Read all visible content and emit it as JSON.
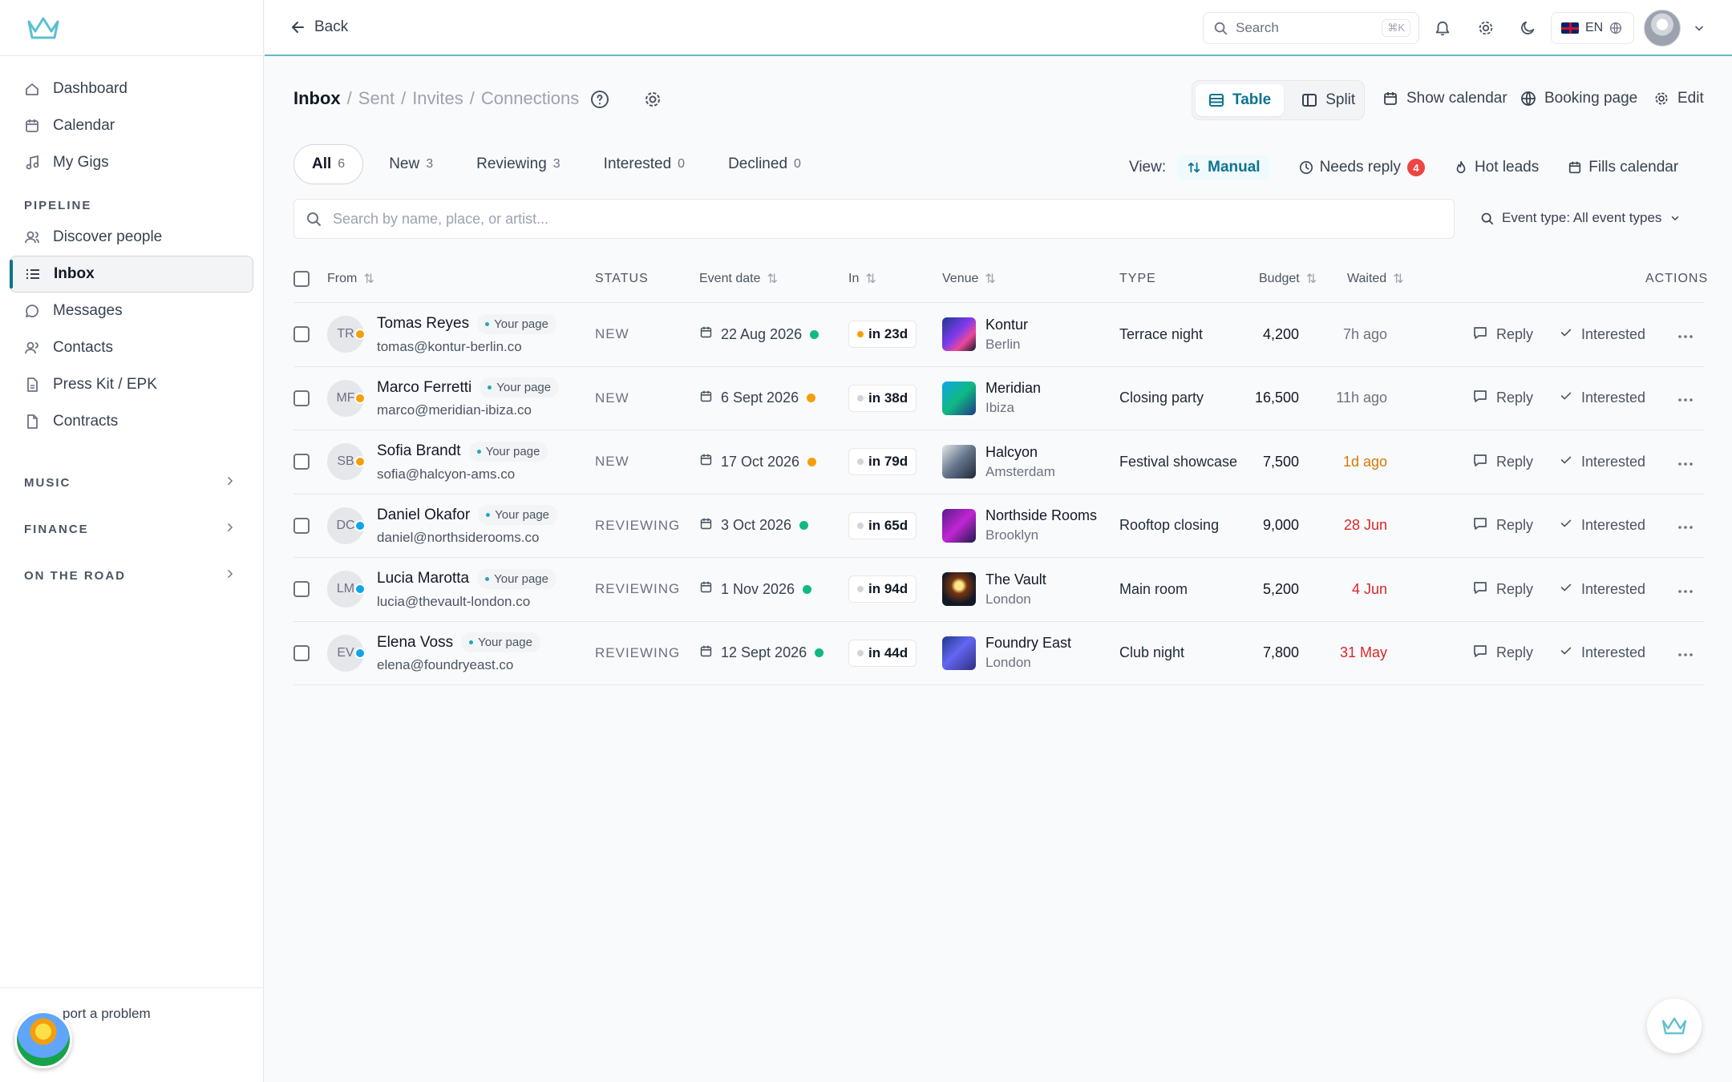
{
  "app": {
    "brand_color": "#5bc0d0"
  },
  "sidebar": {
    "main_items": [
      {
        "label": "Dashboard",
        "icon": "home-icon"
      },
      {
        "label": "Calendar",
        "icon": "calendar-icon"
      },
      {
        "label": "My Gigs",
        "icon": "music-note-icon"
      }
    ],
    "pipeline_label": "PIPELINE",
    "pipeline_items": [
      {
        "label": "Discover people",
        "icon": "users-icon"
      },
      {
        "label": "Inbox",
        "icon": "list-icon",
        "active": true
      },
      {
        "label": "Messages",
        "icon": "message-icon"
      },
      {
        "label": "Contacts",
        "icon": "contacts-icon"
      },
      {
        "label": "Press Kit / EPK",
        "icon": "file-icon"
      },
      {
        "label": "Contracts",
        "icon": "document-icon"
      }
    ],
    "groups": [
      "MUSIC",
      "FINANCE",
      "ON THE ROAD"
    ],
    "footer_label": "port a problem"
  },
  "topbar": {
    "back_label": "Back",
    "search_placeholder": "Search",
    "search_shortcut": "⌘K",
    "lang": "EN"
  },
  "header": {
    "crumbs": [
      "Inbox",
      "Sent",
      "Invites",
      "Connections"
    ],
    "view_table": "Table",
    "view_split": "Split",
    "show_calendar": "Show calendar",
    "booking_page": "Booking page",
    "edit": "Edit"
  },
  "tabs": [
    {
      "label": "All",
      "count": "6",
      "active": true
    },
    {
      "label": "New",
      "count": "3"
    },
    {
      "label": "Reviewing",
      "count": "3"
    },
    {
      "label": "Interested",
      "count": "0"
    },
    {
      "label": "Declined",
      "count": "0"
    }
  ],
  "viewbar": {
    "label": "View:",
    "manual": "Manual",
    "needs_reply": "Needs reply",
    "needs_reply_count": "4",
    "hot_leads": "Hot leads",
    "fills_calendar": "Fills calendar"
  },
  "search": {
    "placeholder": "Search by name, place, or artist...",
    "event_type": "Event type: All event types"
  },
  "table": {
    "headers": {
      "from": "From",
      "status": "STATUS",
      "event_date": "Event date",
      "in": "In",
      "venue": "Venue",
      "type": "TYPE",
      "budget": "Budget",
      "waited": "Waited",
      "actions": "ACTIONS"
    },
    "your_page_label": "Your page",
    "reply_label": "Reply",
    "interested_label": "Interested",
    "rows": [
      {
        "initials": "TR",
        "name": "Tomas Reyes",
        "email": "tomas@kontur-berlin.co",
        "status": "NEW",
        "date": "22 Aug 2026",
        "in": "in 23d",
        "venue": "Kontur",
        "city": "Berlin",
        "type": "Terrace night",
        "budget": "4,200",
        "waited": "7h ago",
        "avatar_dot": "#f59e0b",
        "date_dot": "#10b981",
        "in_dot": "#f59e0b",
        "waited_color": "#6b7280",
        "thumb": "linear-gradient(135deg,#1e3a8a,#7c3aed 45%,#ec4899 70%,#0f172a)"
      },
      {
        "initials": "MF",
        "name": "Marco Ferretti",
        "email": "marco@meridian-ibiza.co",
        "status": "NEW",
        "date": "6 Sept 2026",
        "in": "in 38d",
        "venue": "Meridian",
        "city": "Ibiza",
        "type": "Closing party",
        "budget": "16,500",
        "waited": "11h ago",
        "avatar_dot": "#f59e0b",
        "date_dot": "#f59e0b",
        "in_dot": "#d1d5db",
        "waited_color": "#6b7280",
        "thumb": "linear-gradient(135deg,#0ea5e9,#10b981 50%,#1e3a8a)"
      },
      {
        "initials": "SB",
        "name": "Sofia Brandt",
        "email": "sofia@halcyon-ams.co",
        "status": "NEW",
        "date": "17 Oct 2026",
        "in": "in 79d",
        "venue": "Halcyon",
        "city": "Amsterdam",
        "type": "Festival showcase",
        "budget": "7,500",
        "waited": "1d ago",
        "avatar_dot": "#f59e0b",
        "date_dot": "#f59e0b",
        "in_dot": "#d1d5db",
        "waited_color": "#d97706",
        "thumb": "linear-gradient(135deg,#e5e7eb,#64748b 50%,#1f2937)"
      },
      {
        "initials": "DC",
        "name": "Daniel Okafor",
        "email": "daniel@northsiderooms.co",
        "status": "REVIEWING",
        "date": "3 Oct 2026",
        "in": "in 65d",
        "venue": "Northside Rooms",
        "city": "Brooklyn",
        "type": "Rooftop closing",
        "budget": "9,000",
        "waited": "28 Jun",
        "avatar_dot": "#0ea5e9",
        "date_dot": "#10b981",
        "in_dot": "#d1d5db",
        "waited_color": "#dc2626",
        "thumb": "linear-gradient(135deg,#581c87,#c026d3 50%,#1e1b4b)"
      },
      {
        "initials": "LM",
        "name": "Lucia Marotta",
        "email": "lucia@thevault-london.co",
        "status": "REVIEWING",
        "date": "1 Nov 2026",
        "in": "in 94d",
        "venue": "The Vault",
        "city": "London",
        "type": "Main room",
        "budget": "5,200",
        "waited": "4 Jun",
        "avatar_dot": "#0ea5e9",
        "date_dot": "#10b981",
        "in_dot": "#d1d5db",
        "waited_color": "#dc2626",
        "thumb": "radial-gradient(circle at 50% 40%,#fde68a 0 15%,#78350f 30%,#111827 70%)"
      },
      {
        "initials": "EV",
        "name": "Elena Voss",
        "email": "elena@foundryeast.co",
        "status": "REVIEWING",
        "date": "12 Sept 2026",
        "in": "in 44d",
        "venue": "Foundry East",
        "city": "London",
        "type": "Club night",
        "budget": "7,800",
        "waited": "31 May",
        "avatar_dot": "#0ea5e9",
        "date_dot": "#10b981",
        "in_dot": "#d1d5db",
        "waited_color": "#dc2626",
        "thumb": "linear-gradient(135deg,#1e3a8a,#6366f1 45%,#312e81)"
      }
    ]
  }
}
